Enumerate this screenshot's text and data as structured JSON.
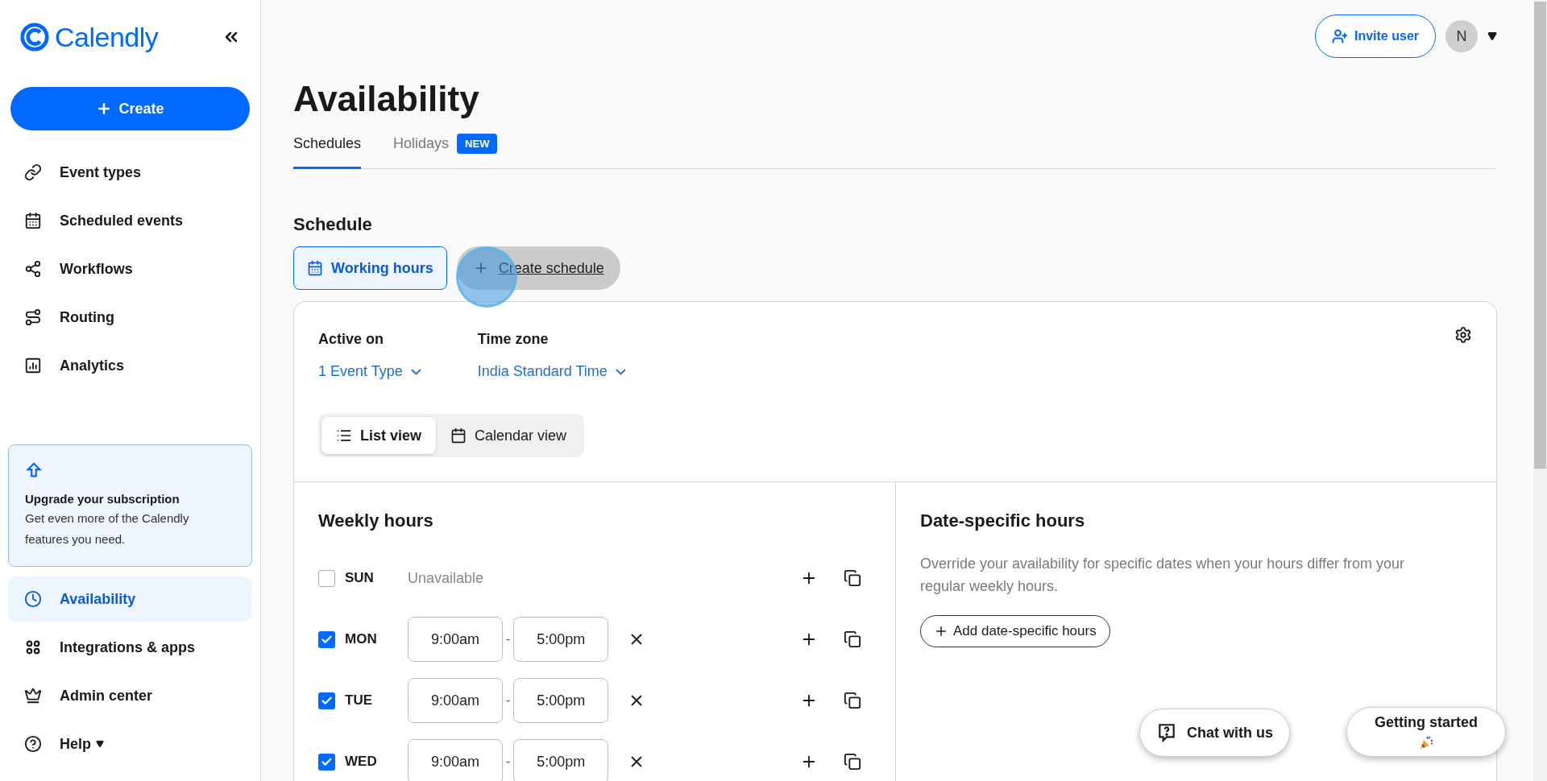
{
  "sidebar": {
    "logo": "Calendly",
    "create_button": "Create",
    "nav_top": [
      {
        "label": "Event types",
        "selected": false
      },
      {
        "label": "Scheduled events",
        "selected": false
      },
      {
        "label": "Workflows",
        "selected": false
      },
      {
        "label": "Routing",
        "selected": false
      },
      {
        "label": "Analytics",
        "selected": false
      }
    ],
    "upgrade_card": {
      "title": "Upgrade your subscription",
      "text": "Get even more of the Calendly features you need."
    },
    "nav_bottom": [
      {
        "label": "Availability",
        "selected": true,
        "has_menu": false
      },
      {
        "label": "Integrations & apps",
        "selected": false,
        "has_menu": false
      },
      {
        "label": "Admin center",
        "selected": false,
        "has_menu": false
      },
      {
        "label": "Help",
        "selected": false,
        "has_menu": true
      }
    ]
  },
  "header": {
    "invite_button": "Invite user",
    "avatar": "N"
  },
  "page_title": "Availability",
  "tabs": [
    {
      "label": "Schedules",
      "selected": true
    },
    {
      "label": "Holidays",
      "selected": false,
      "badge": "NEW"
    }
  ],
  "schedule": {
    "heading": "Schedule",
    "schedules": [
      {
        "label": "Working hours",
        "selected": true
      }
    ],
    "create_button": "Create schedule",
    "active_on": {
      "label": "Active on",
      "value": "1 Event Type"
    },
    "time_zone": {
      "label": "Time zone",
      "value": "India Standard Time"
    },
    "views": [
      {
        "label": "List view",
        "selected": true
      },
      {
        "label": "Calendar view",
        "selected": false
      }
    ],
    "weekly_hours": {
      "title": "Weekly hours",
      "days": [
        {
          "day": "SUN",
          "checked": false,
          "status": "Unavailable"
        },
        {
          "day": "MON",
          "checked": true,
          "intervals": [
            {
              "start": "9:00am",
              "separator": "-",
              "end": "5:00pm"
            }
          ]
        },
        {
          "day": "TUE",
          "checked": true,
          "intervals": [
            {
              "start": "9:00am",
              "separator": "-",
              "end": "5:00pm"
            }
          ]
        },
        {
          "day": "WED",
          "checked": true,
          "intervals": [
            {
              "start": "9:00am",
              "separator": "-",
              "end": "5:00pm"
            }
          ]
        }
      ]
    },
    "date_specific": {
      "title": "Date-specific hours",
      "description": "Override your availability for specific dates when your hours differ from your regular weekly hours.",
      "add_button": "Add date-specific hours"
    }
  },
  "chat_button": "Chat with us",
  "getting_started_button": "Getting started"
}
